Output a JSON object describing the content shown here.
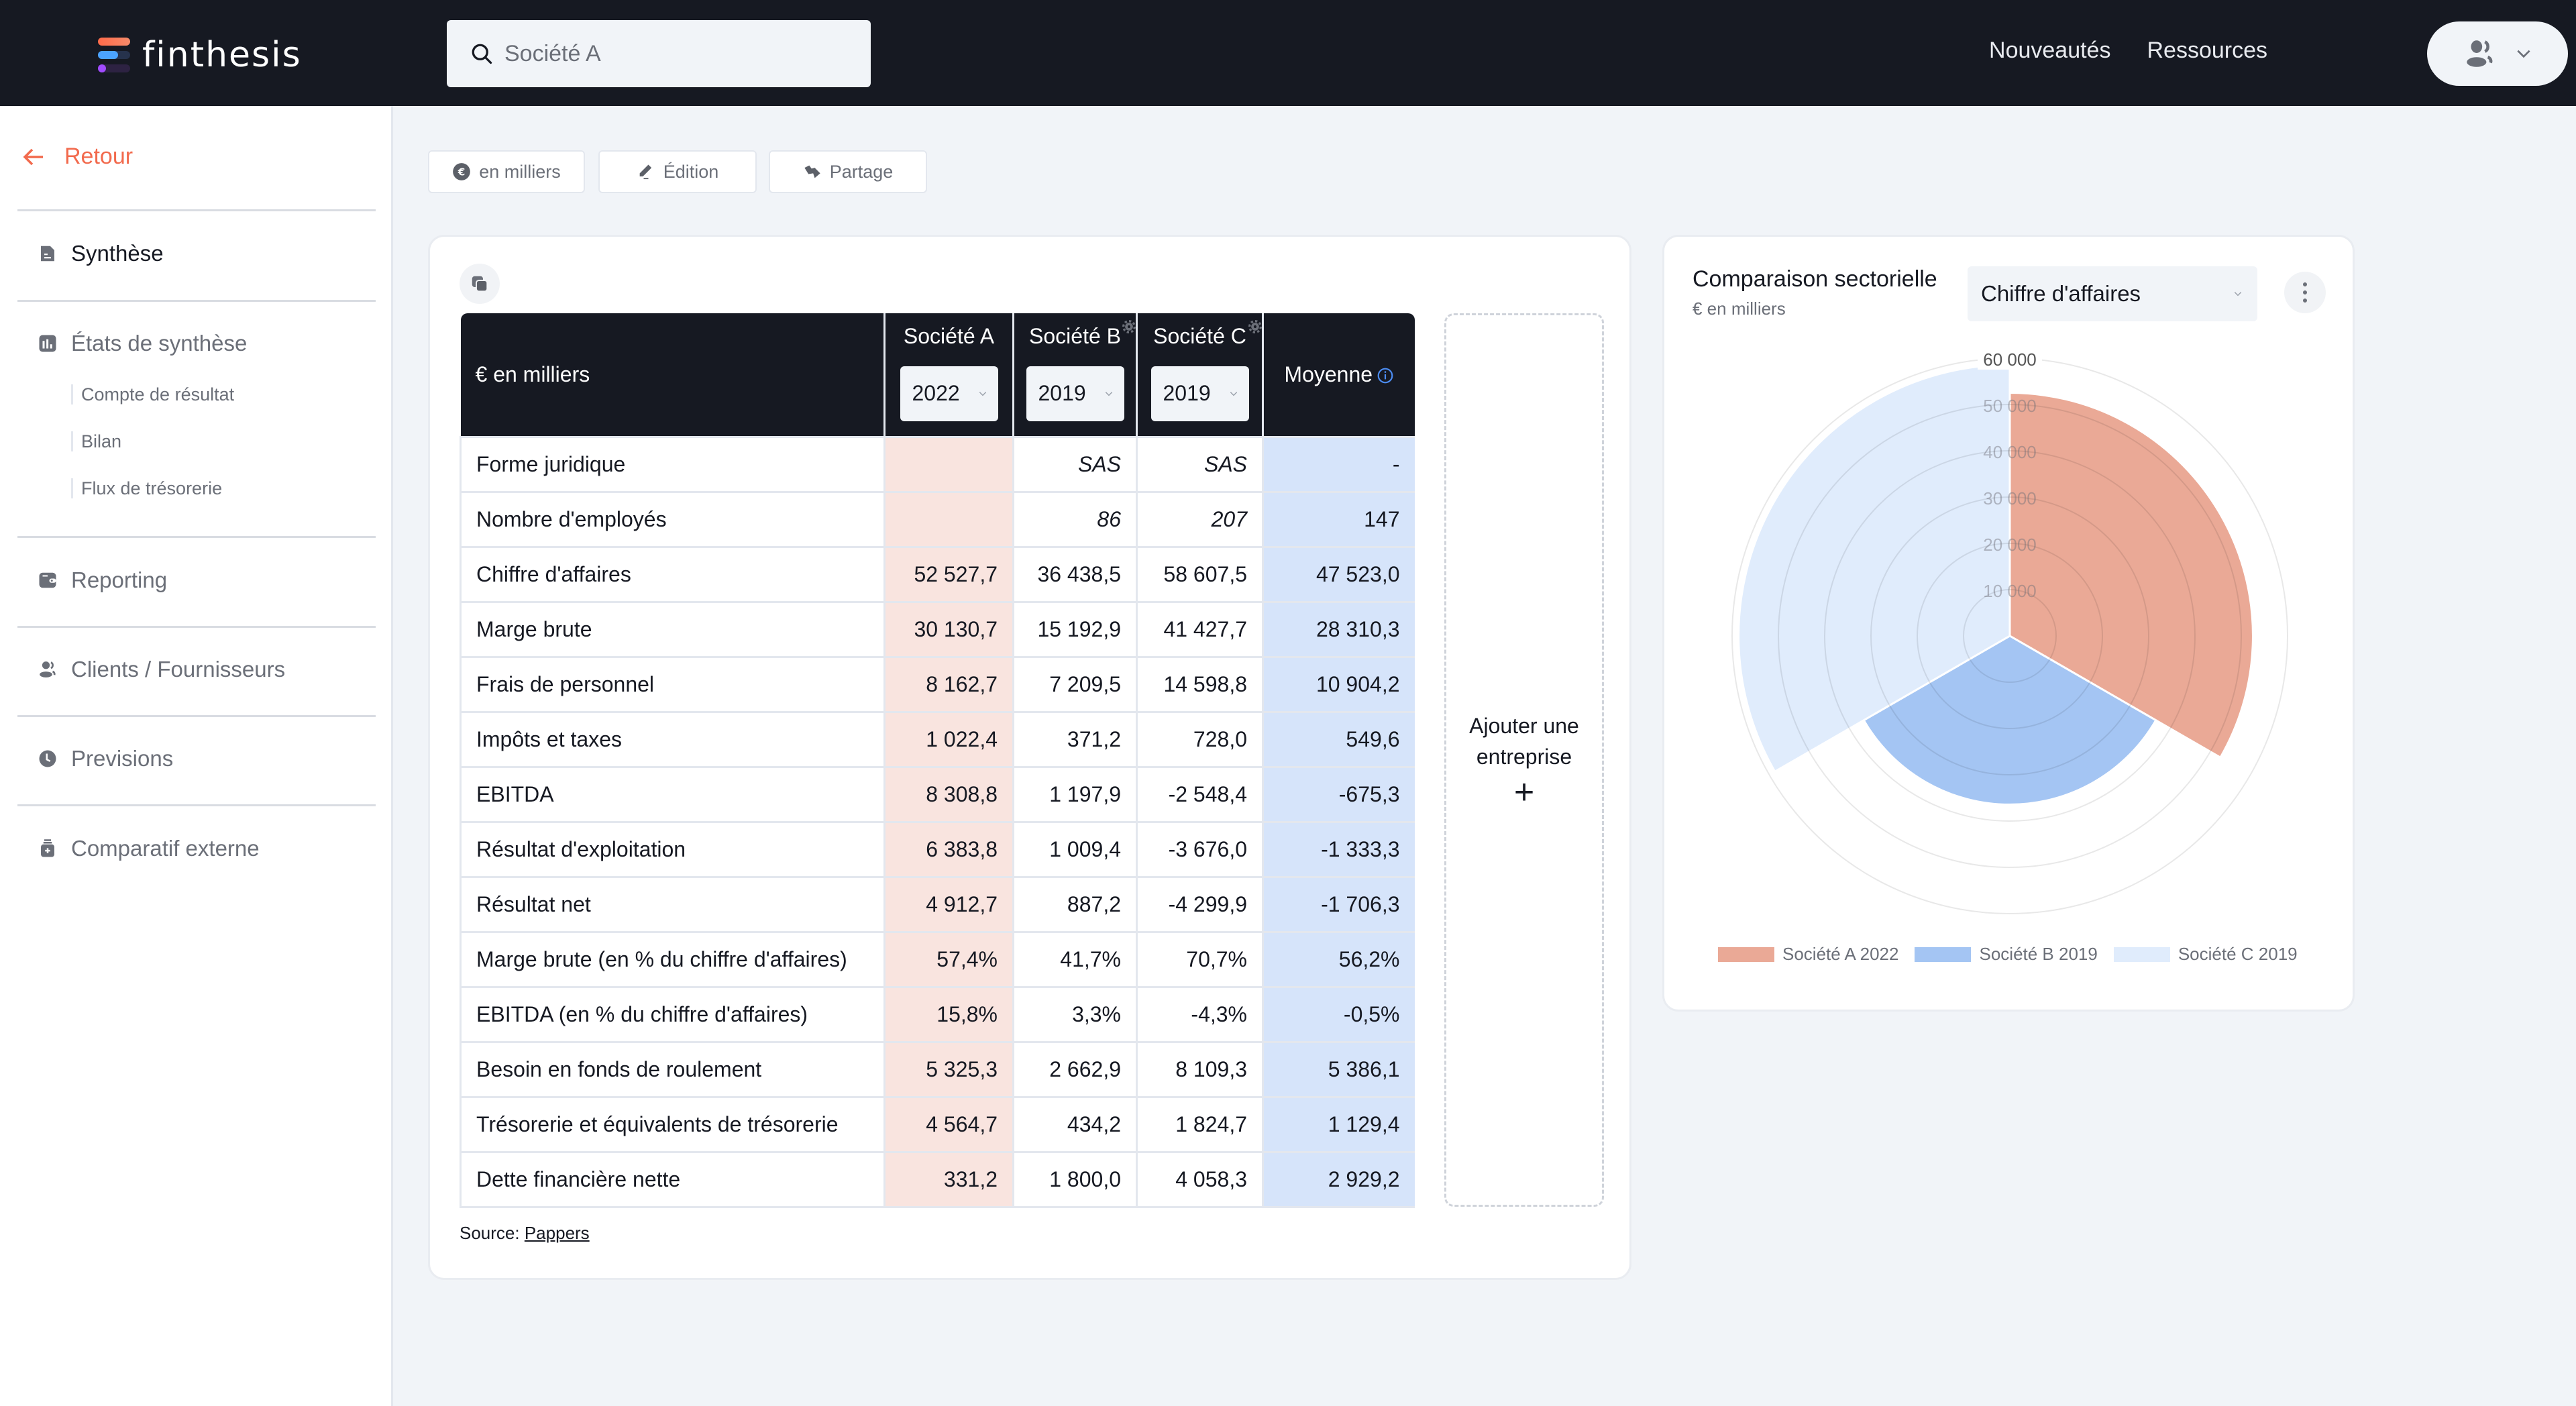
{
  "app": {
    "brand": "finthesis",
    "search": {
      "value": "Société A",
      "placeholder": "Société A"
    },
    "top_links": [
      "Nouveautés",
      "Ressources"
    ]
  },
  "sidebar": {
    "back_label": "Retour",
    "items": [
      {
        "label": "Synthèse",
        "icon": "document-icon",
        "active": true
      },
      {
        "label": "États de synthèse",
        "icon": "bar-chart-icon",
        "active": false,
        "children": [
          "Compte de résultat",
          "Bilan",
          "Flux de trésorerie"
        ]
      },
      {
        "label": "Reporting",
        "icon": "wallet-icon",
        "active": false
      },
      {
        "label": "Clients / Fournisseurs",
        "icon": "users-icon",
        "active": false
      },
      {
        "label": "Previsions",
        "icon": "clock-icon",
        "active": false
      },
      {
        "label": "Comparatif externe",
        "icon": "jar-plus-icon",
        "active": false
      }
    ]
  },
  "toolbar": {
    "unit_label": "en milliers",
    "edit_label": "Édition",
    "share_label": "Partage"
  },
  "table": {
    "corner_label": "€ en milliers",
    "companies": [
      {
        "name": "Société A",
        "year": "2022"
      },
      {
        "name": "Société B",
        "year": "2019"
      },
      {
        "name": "Société C",
        "year": "2019"
      }
    ],
    "average_label": "Moyenne",
    "rows": [
      {
        "label": "Forme juridique",
        "a": "",
        "b": "SAS",
        "c": "SAS",
        "avg": "-",
        "italic": true
      },
      {
        "label": "Nombre d'employés",
        "a": "",
        "b": "86",
        "c": "207",
        "avg": "147",
        "italic": true
      },
      {
        "label": "Chiffre d'affaires",
        "a": "52 527,7",
        "b": "36 438,5",
        "c": "58 607,5",
        "avg": "47 523,0"
      },
      {
        "label": "Marge brute",
        "a": "30 130,7",
        "b": "15 192,9",
        "c": "41 427,7",
        "avg": "28 310,3"
      },
      {
        "label": "Frais de personnel",
        "a": "8 162,7",
        "b": "7 209,5",
        "c": "14 598,8",
        "avg": "10 904,2"
      },
      {
        "label": "Impôts et taxes",
        "a": "1 022,4",
        "b": "371,2",
        "c": "728,0",
        "avg": "549,6"
      },
      {
        "label": "EBITDA",
        "a": "8 308,8",
        "b": "1 197,9",
        "c": "-2 548,4",
        "avg": "-675,3"
      },
      {
        "label": "Résultat d'exploitation",
        "a": "6 383,8",
        "b": "1 009,4",
        "c": "-3 676,0",
        "avg": "-1 333,3"
      },
      {
        "label": "Résultat net",
        "a": "4 912,7",
        "b": "887,2",
        "c": "-4 299,9",
        "avg": "-1 706,3"
      },
      {
        "label": "Marge brute (en % du chiffre d'affaires)",
        "a": "57,4%",
        "b": "41,7%",
        "c": "70,7%",
        "avg": "56,2%"
      },
      {
        "label": "EBITDA (en % du chiffre d'affaires)",
        "a": "15,8%",
        "b": "3,3%",
        "c": "-4,3%",
        "avg": "-0,5%"
      },
      {
        "label": "Besoin en fonds de roulement",
        "a": "5 325,3",
        "b": "2 662,9",
        "c": "8 109,3",
        "avg": "5 386,1"
      },
      {
        "label": "Trésorerie et équivalents de trésorerie",
        "a": "4 564,7",
        "b": "434,2",
        "c": "1 824,7",
        "avg": "1 129,4"
      },
      {
        "label": "Dette financière nette",
        "a": "331,2",
        "b": "1 800,0",
        "c": "4 058,3",
        "avg": "2 929,2"
      }
    ],
    "source_prefix": "Source:",
    "source_link": "Pappers",
    "add_company": {
      "label": "Ajouter une entreprise",
      "icon": "+"
    }
  },
  "panel": {
    "title": "Comparaison sectorielle",
    "subtitle": "€ en milliers",
    "metric_selected": "Chiffre d'affaires"
  },
  "chart_data": {
    "type": "polarArea",
    "title": "Comparaison sectorielle",
    "metric": "Chiffre d'affaires",
    "unit": "€ en milliers",
    "categories": [
      "Société A 2022",
      "Société B 2019",
      "Société C 2019"
    ],
    "values": [
      52527.7,
      36438.5,
      58607.5
    ],
    "colors": [
      "#eaa996",
      "#a4c5f3",
      "#e0ecfc"
    ],
    "rlim": [
      0,
      60000
    ],
    "ticks": [
      10000,
      20000,
      30000,
      40000,
      50000,
      60000
    ],
    "tick_labels": [
      "10 000",
      "20 000",
      "30 000",
      "40 000",
      "50 000",
      "60 000"
    ],
    "grid": true,
    "legend_position": "bottom"
  },
  "colors": {
    "accent": "#f26a4d",
    "header_bg": "#161922",
    "company_a_bg": "#f9e4df",
    "average_bg": "#d6e4fa"
  }
}
